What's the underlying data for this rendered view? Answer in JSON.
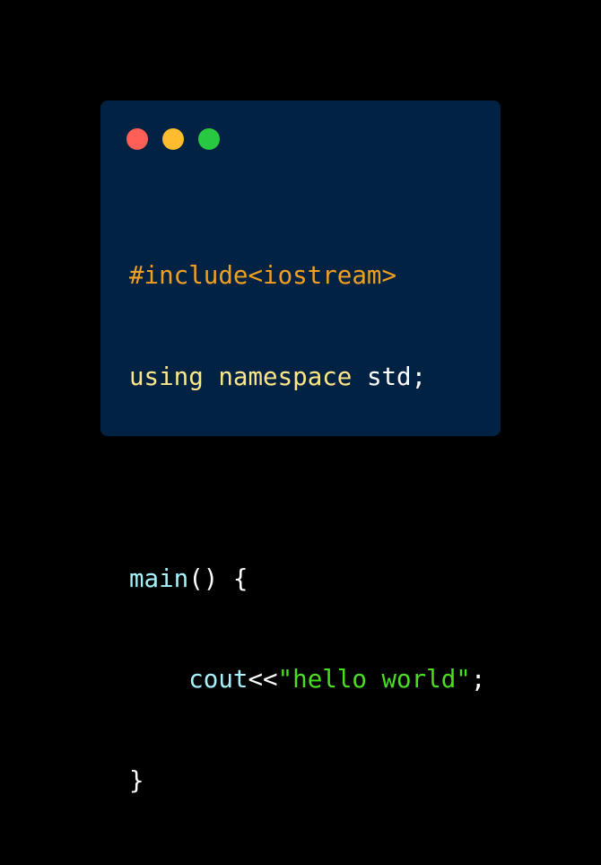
{
  "colors": {
    "page_background": "#000000",
    "window_background": "#012243",
    "dot_close": "#ff5f57",
    "dot_minimize": "#febc2e",
    "dot_maximize": "#28c840",
    "preprocessor": "#f0a020",
    "keyword": "#fde68a",
    "plain": "#ffffff",
    "function": "#a5f3fc",
    "string": "#4ade20"
  },
  "window_controls": [
    "close",
    "minimize",
    "maximize"
  ],
  "code": {
    "line1": {
      "include": "#include<iostream>"
    },
    "line2": {
      "kw_using": "using",
      "kw_namespace": "namespace",
      "ident_std": "std;"
    },
    "line4": {
      "func_main": "main",
      "rest": "() {"
    },
    "line5": {
      "indent": "    ",
      "func_cout": "cout",
      "op": "<<",
      "string": "\"hello world\"",
      "semi": ";"
    },
    "line6": {
      "brace": "}"
    }
  }
}
